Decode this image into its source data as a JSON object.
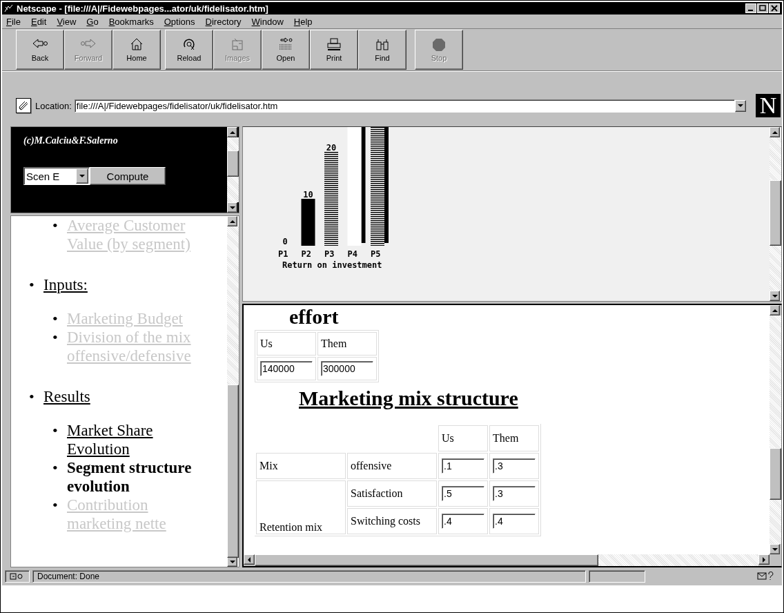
{
  "window": {
    "title": "Netscape - [file:///A|/Fidewebpages...ator/uk/fidelisator.htm]"
  },
  "menu": [
    "File",
    "Edit",
    "View",
    "Go",
    "Bookmarks",
    "Options",
    "Directory",
    "Window",
    "Help"
  ],
  "toolbar": [
    [
      {
        "label": "Back",
        "kind": "back",
        "disabled": false
      },
      {
        "label": "Forward",
        "kind": "forward",
        "disabled": true
      },
      {
        "label": "Home",
        "kind": "home",
        "disabled": false
      }
    ],
    [
      {
        "label": "Reload",
        "kind": "reload",
        "disabled": false
      },
      {
        "label": "Images",
        "kind": "images",
        "disabled": true
      },
      {
        "label": "Open",
        "kind": "open",
        "disabled": false
      },
      {
        "label": "Print",
        "kind": "print",
        "disabled": false
      },
      {
        "label": "Find",
        "kind": "find",
        "disabled": false
      }
    ],
    [
      {
        "label": "Stop",
        "kind": "stop",
        "disabled": true
      }
    ]
  ],
  "location": {
    "label": "Location:",
    "value": "file:///A|/Fidewebpages/fidelisator/uk/fidelisator.htm"
  },
  "logo": {
    "text": "N"
  },
  "scenario_frame": {
    "credit": "(c)M.Calciu&F.Salerno",
    "scenario": "Scen E",
    "button": "Compute"
  },
  "nav": [
    {
      "children": [
        {
          "bullet": "•",
          "label": "Average Customer Value (by segment)",
          "kind": "faded"
        }
      ]
    },
    {
      "bullet": "•",
      "label": "Inputs:",
      "kind": "link",
      "children": [
        {
          "bullet": "•",
          "label": "Marketing Budget",
          "kind": "faded"
        },
        {
          "bullet": "•",
          "label": "Division of the mix offensive/defensive",
          "kind": "faded"
        }
      ]
    },
    {
      "bullet": "•",
      "label": "Results",
      "kind": "link",
      "children": [
        {
          "bullet": "•",
          "label": "Market Share Evolution",
          "kind": "link"
        },
        {
          "bullet": "•",
          "label": "Segment structure evolution",
          "kind": "current"
        },
        {
          "bullet": "•",
          "label": "Contribution marketing nette",
          "kind": "faded"
        }
      ]
    }
  ],
  "chart": {
    "chart_data": {
      "type": "bar",
      "xlabel": "Return on investment",
      "categories": [
        "P1",
        "P2",
        "P3",
        "P4",
        "P5"
      ],
      "values": [
        0,
        10,
        20,
        null,
        null
      ],
      "data_labels": true
    }
  },
  "content": {
    "cut_heading": "effort",
    "budget": {
      "columns": [
        "Us",
        "Them"
      ],
      "values": [
        "140000",
        "300000"
      ]
    },
    "heading": "Marketing mix structure",
    "mix": {
      "columns": [
        "Us",
        "Them"
      ],
      "groups": [
        {
          "label": "Mix",
          "rows": [
            {
              "item": "offensive",
              "values": [
                ".1",
                ".3"
              ]
            }
          ]
        },
        {
          "label": "Retention mix",
          "rows": [
            {
              "item": "Satisfaction",
              "values": [
                ".5",
                ".3"
              ]
            },
            {
              "item": "Switching costs",
              "values": [
                ".4",
                ".4"
              ]
            }
          ]
        }
      ]
    }
  },
  "status_bar": {
    "text": "Document: Done"
  }
}
